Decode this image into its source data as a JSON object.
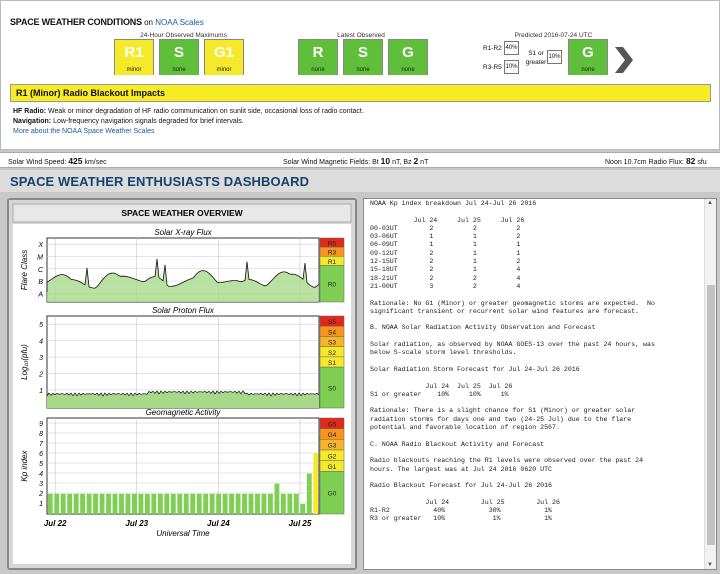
{
  "conditions": {
    "title": "SPACE WEATHER CONDITIONS",
    "on": "on",
    "link": "NOAA Scales",
    "max24_label": "24-Hour Observed Maximums",
    "latest_label": "Latest Observed",
    "pred_label": "Predicted 2016-07-24 UTC",
    "max24": [
      {
        "l": "R1",
        "s": "minor",
        "c": "yellow"
      },
      {
        "l": "S",
        "s": "none",
        "c": "green"
      },
      {
        "l": "G1",
        "s": "minor",
        "c": "yellow"
      }
    ],
    "latest": [
      {
        "l": "R",
        "s": "none",
        "c": "green"
      },
      {
        "l": "S",
        "s": "none",
        "c": "green"
      },
      {
        "l": "G",
        "s": "none",
        "c": "green"
      }
    ],
    "pred": {
      "r12": "R1-R2",
      "r35": "R3-R5",
      "v12": "40%",
      "v35": "10%",
      "s1": "S1 or greater",
      "sv": "10%",
      "g": "G",
      "gs": "none"
    }
  },
  "alert": {
    "title": "R1 (Minor) Radio Blackout Impacts",
    "hf_label": "HF Radio:",
    "hf": " Weak or minor degradation of HF radio communication on sunlit side, occasional loss of radio contact.",
    "nav_label": "Navigation:",
    "nav": " Low-frequency navigation signals degraded for brief intervals.",
    "more": "More about the NOAA Space Weather Scales"
  },
  "status": {
    "wind_label": "Solar Wind Speed:",
    "wind_val": "425",
    "wind_unit": "km/sec",
    "mag_label": "Solar Wind Magnetic Fields: Bt",
    "bt": "10",
    "bt_unit": "nT, Bz",
    "bz": "2",
    "bz_unit": "nT",
    "flux_label": "Noon 10.7cm Radio Flux:",
    "flux": "82",
    "flux_unit": "sfu"
  },
  "dashboard_title": "SPACE WEATHER ENTHUSIASTS DASHBOARD",
  "overview": {
    "header": "SPACE WEATHER OVERVIEW",
    "xray_title": "Solar X-ray Flux",
    "xray_ylabel": "Flare Class",
    "xray_ticks": [
      "X",
      "M",
      "C",
      "B",
      "A"
    ],
    "xray_scale": [
      "R5",
      "R3",
      "R1",
      "R0"
    ],
    "proton_title": "Solar Proton Flux",
    "proton_ylabel": "Log₁₀(pfu)",
    "proton_ticks": [
      "5",
      "4",
      "3",
      "2",
      "1"
    ],
    "proton_scale": [
      "S5",
      "S4",
      "S3",
      "S2",
      "S1",
      "S0"
    ],
    "geo_title": "Geomagnetic Activity",
    "geo_ylabel": "Kp index",
    "geo_ticks": [
      "9",
      "8",
      "7",
      "6",
      "5",
      "4",
      "3",
      "2",
      "1"
    ],
    "geo_scale": [
      "G5",
      "G4",
      "G3",
      "G2",
      "G1",
      "G0"
    ],
    "dates": [
      "Jul 22",
      "Jul 23",
      "Jul 24",
      "Jul 25"
    ],
    "xaxis": "Universal Time",
    "kp_values": [
      2,
      2,
      2,
      2,
      2,
      2,
      2,
      2,
      2,
      2,
      2,
      2,
      2,
      2,
      2,
      2,
      2,
      2,
      2,
      2,
      2,
      2,
      2,
      2,
      2,
      2,
      2,
      2,
      2,
      2,
      2,
      2,
      2,
      2,
      2,
      3,
      2,
      2,
      2,
      1,
      4,
      6
    ]
  },
  "report": "NOAA Kp index breakdown Jul 24-Jul 26 2016\n\n           Jul 24     Jul 25     Jul 26\n00-03UT        2          2          2\n03-06UT        1          1          2\n06-09UT        1          1          1\n09-12UT        2          1          1\n12-15UT        2          1          2\n15-18UT        2          1          4\n18-21UT        2          2          4\n21-00UT        3          2          4\n\nRationale: No G1 (Minor) or greater geomagnetic storms are expected.  No\nsignificant transient or recurrent solar wind features are forecast.\n\nB. NOAA Solar Radiation Activity Observation and Forecast\n\nSolar radiation, as observed by NOAA GOES-13 over the past 24 hours, was\nbelow S-scale storm level thresholds.\n\nSolar Radiation Storm Forecast for Jul 24-Jul 26 2016\n\n              Jul 24  Jul 25  Jul 26\nS1 or greater    10%     10%     1%\n\nRationale: There is a slight chance for S1 (Minor) or greater solar\nradiation storms for days one and two (24-25 Jul) due to the flare\npotential and favorable location of region 2567.\n\nC. NOAA Radio Blackout Activity and Forecast\n\nRadio blackouts reaching the R1 levels were observed over the past 24\nhours. The largest was at Jul 24 2016 0620 UTC\n\nRadio Blackout Forecast for Jul 24-Jul 26 2016\n\n              Jul 24        Jul 25        Jul 26\nR1-R2           40%           30%           1%\nR3 or greater   10%            1%           1%"
}
